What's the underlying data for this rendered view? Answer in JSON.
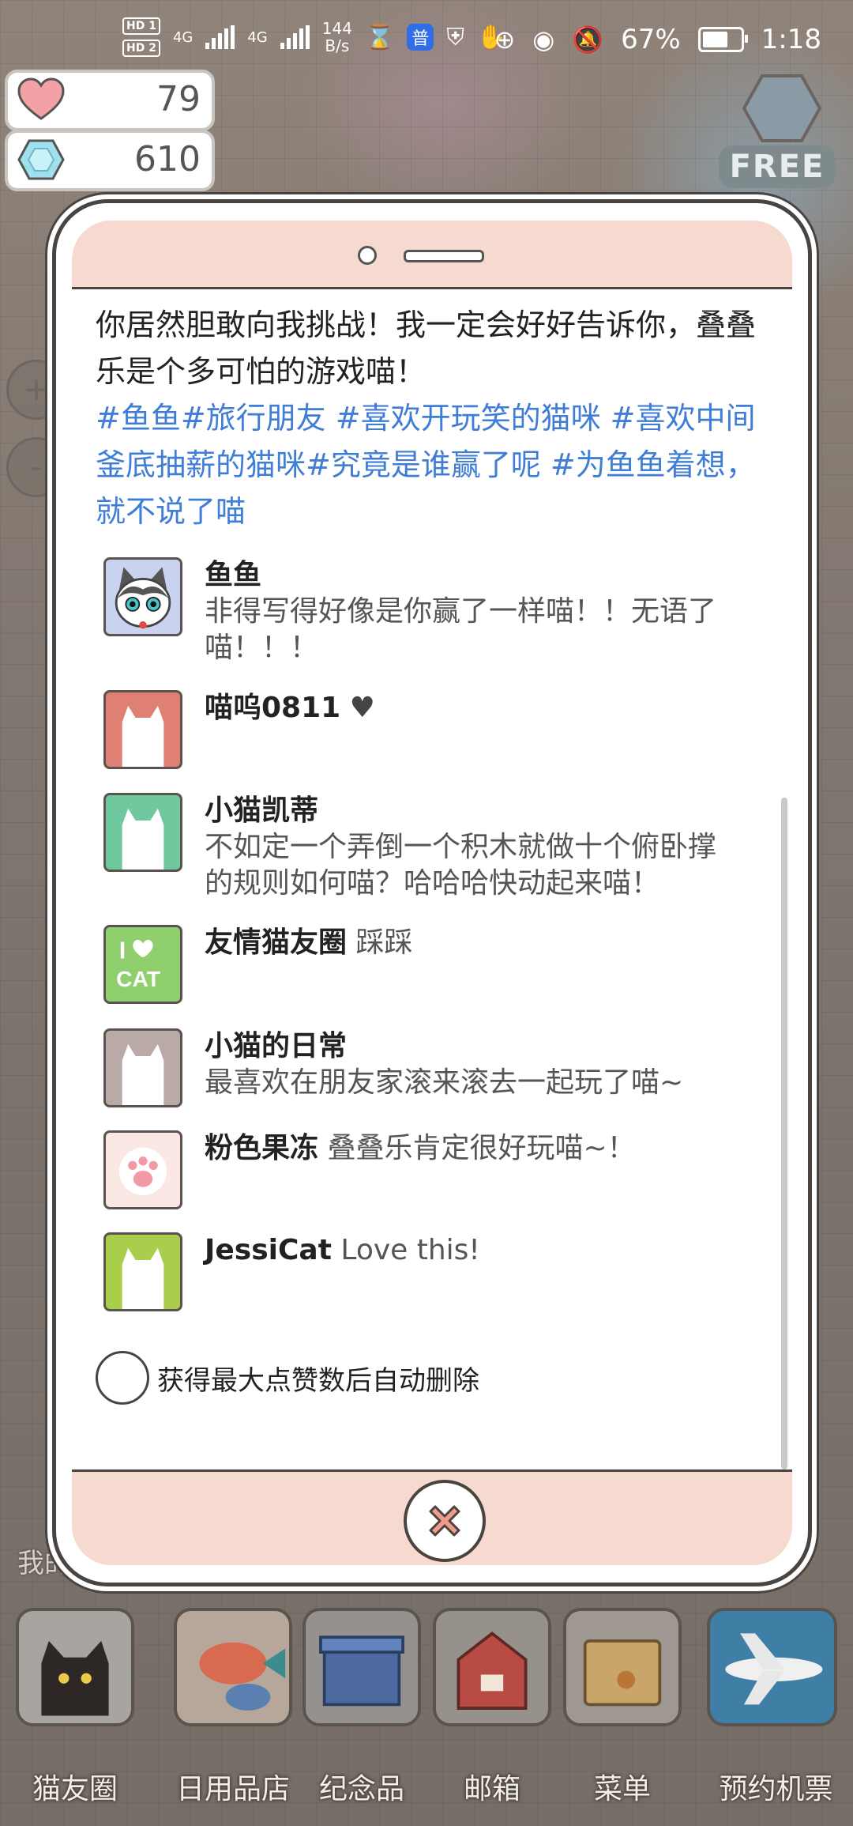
{
  "status_bar": {
    "hd1": "HD 1",
    "hd2": "HD 2",
    "net1": "4G",
    "net2": "4G",
    "speed_value": "144",
    "speed_unit": "B/s",
    "app_glyph": "普",
    "battery": "67%",
    "time": "1:18"
  },
  "currency": {
    "hearts": "79",
    "gems": "610"
  },
  "free_label": "FREE",
  "zoom": {
    "in": "+",
    "out": "-"
  },
  "post": {
    "text": "你居然胆敢向我挑战！我一定会好好告诉你，叠叠乐是个多可怕的游戏喵！",
    "tags": "#鱼鱼#旅行朋友 #喜欢开玩笑的猫咪 #喜欢中间釜底抽薪的猫咪#究竟是谁赢了呢 #为鱼鱼着想，就不说了喵"
  },
  "comments": [
    {
      "name": "鱼鱼",
      "text": "非得写得好像是你赢了一样喵！！无语了喵！！！",
      "avatar": "cat-face-avatar"
    },
    {
      "name": "喵呜0811",
      "text": "♥",
      "avatar": "pink-cat-avatar"
    },
    {
      "name": "小猫凯蒂",
      "text": "不如定一个弄倒一个积木就做十个俯卧撑的规则如何喵？哈哈哈快动起来喵！",
      "avatar": "green-cat-avatar"
    },
    {
      "name": "友情猫友圈",
      "text": "踩踩",
      "avatar": "i-love-cat-avatar"
    },
    {
      "name": "小猫的日常",
      "text": "最喜欢在朋友家滚来滚去一起玩了喵~",
      "avatar": "grey-cat-avatar"
    },
    {
      "name": "粉色果冻",
      "text": "叠叠乐肯定很好玩喵~！",
      "avatar": "paw-avatar"
    },
    {
      "name": "JessiCat",
      "text": "Love this!",
      "avatar": "lime-cat-avatar"
    }
  ],
  "auto_delete_label": "获得最大点赞数后自动删除",
  "background_label": "我的房",
  "dock": [
    {
      "label": "猫友圈",
      "icon": "black-cat-icon"
    },
    {
      "label": "日用品店",
      "icon": "fish-shop-icon"
    },
    {
      "label": "纪念品",
      "icon": "box-icon"
    },
    {
      "label": "邮箱",
      "icon": "mailbox-icon"
    },
    {
      "label": "菜单",
      "icon": "folder-icon"
    },
    {
      "label": "预约机票",
      "icon": "airplane-icon"
    }
  ],
  "colors": {
    "tag_blue": "#3f7dd6",
    "modal_pink": "#f6d9cf",
    "outline": "#4a4441"
  }
}
